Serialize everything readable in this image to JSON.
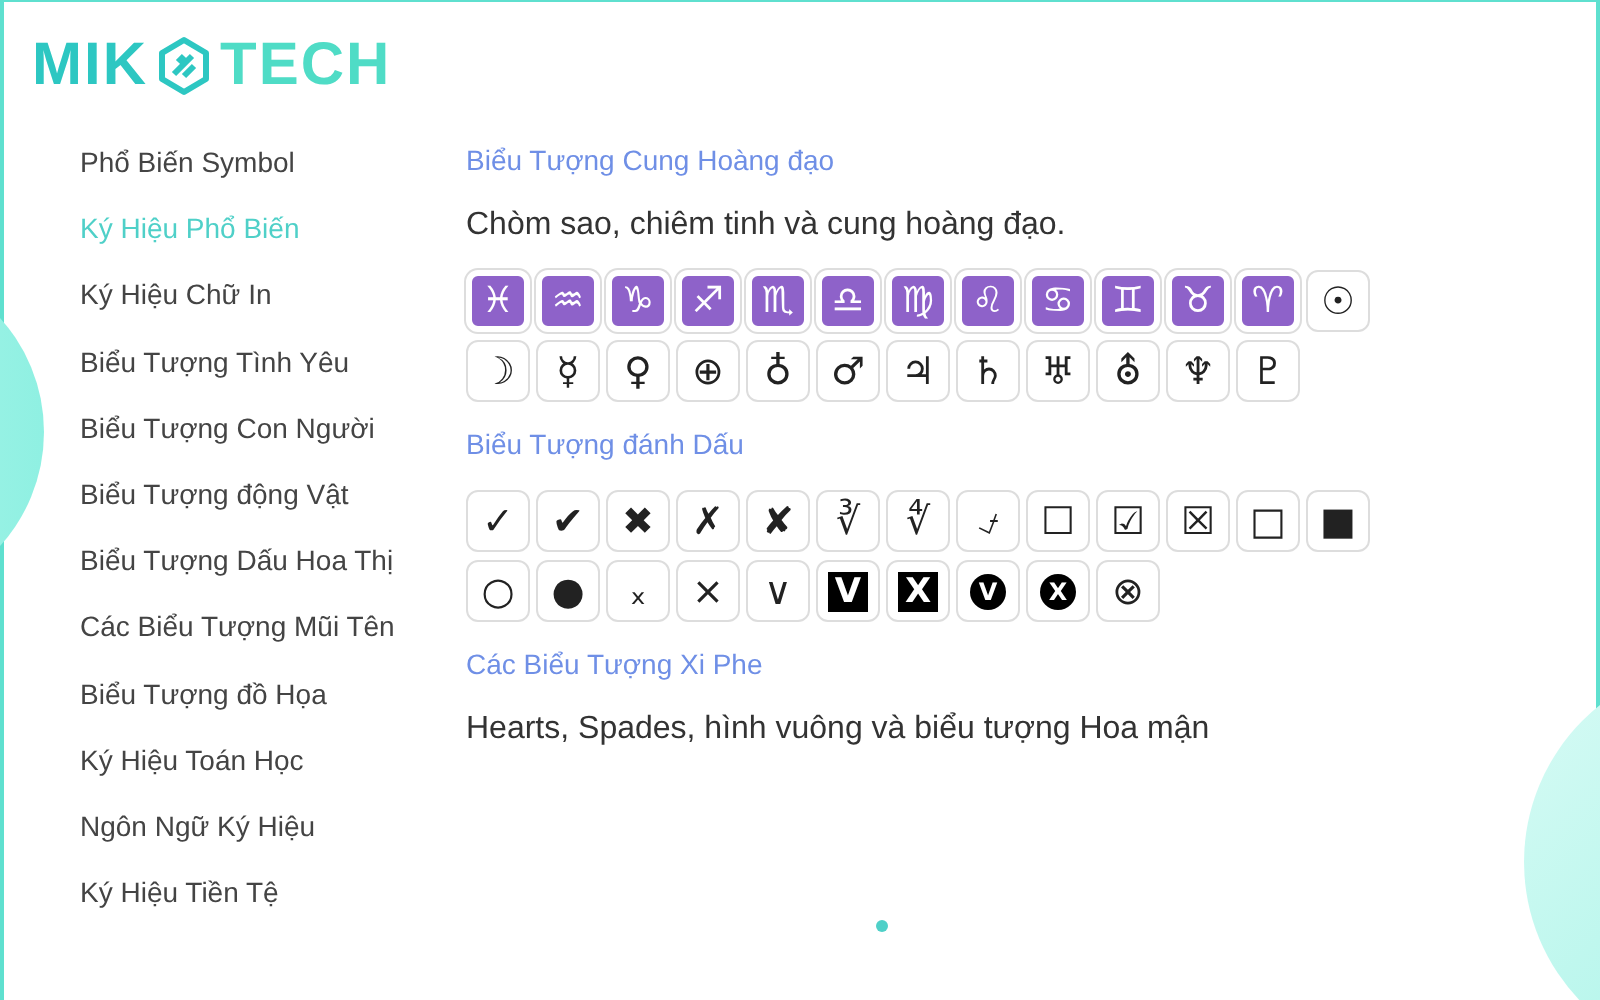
{
  "logo": {
    "left": "MIK",
    "right": "TECH"
  },
  "sidebar": {
    "items": [
      {
        "label": "Phổ Biến Symbol",
        "selected": false
      },
      {
        "label": "Ký Hiệu Phổ Biến",
        "selected": true
      },
      {
        "label": "Ký Hiệu Chữ In",
        "selected": false
      },
      {
        "label": "Biểu Tượng Tình Yêu",
        "selected": false
      },
      {
        "label": "Biểu Tượng Con Người",
        "selected": false
      },
      {
        "label": "Biểu Tượng động Vật",
        "selected": false
      },
      {
        "label": "Biểu Tượng Dấu Hoa Thị",
        "selected": false
      },
      {
        "label": "Các Biểu Tượng Mũi Tên",
        "selected": false
      },
      {
        "label": "Biểu Tượng đồ Họa",
        "selected": false
      },
      {
        "label": "Ký Hiệu Toán Học",
        "selected": false
      },
      {
        "label": "Ngôn Ngữ Ký Hiệu",
        "selected": false
      },
      {
        "label": "Ký Hiệu Tiền Tệ",
        "selected": false
      }
    ]
  },
  "sections": [
    {
      "title": "Biểu Tượng Cung Hoàng đạo",
      "description": "Chòm sao, chiêm tinh và cung hoàng đạo.",
      "symbols": [
        {
          "char": "♓",
          "kind": "zodiac"
        },
        {
          "char": "♒",
          "kind": "zodiac"
        },
        {
          "char": "♑",
          "kind": "zodiac"
        },
        {
          "char": "♐",
          "kind": "zodiac"
        },
        {
          "char": "♏",
          "kind": "zodiac"
        },
        {
          "char": "♎",
          "kind": "zodiac"
        },
        {
          "char": "♍",
          "kind": "zodiac"
        },
        {
          "char": "♌",
          "kind": "zodiac"
        },
        {
          "char": "♋",
          "kind": "zodiac"
        },
        {
          "char": "♊",
          "kind": "zodiac"
        },
        {
          "char": "♉",
          "kind": "zodiac"
        },
        {
          "char": "♈",
          "kind": "zodiac"
        },
        {
          "char": "☉",
          "kind": "plain"
        },
        {
          "char": "☽",
          "kind": "plain"
        },
        {
          "char": "☿",
          "kind": "plain"
        },
        {
          "char": "♀",
          "kind": "plain"
        },
        {
          "char": "⊕",
          "kind": "plain"
        },
        {
          "char": "♁",
          "kind": "plain"
        },
        {
          "char": "♂",
          "kind": "plain"
        },
        {
          "char": "♃",
          "kind": "plain"
        },
        {
          "char": "♄",
          "kind": "plain"
        },
        {
          "char": "♅",
          "kind": "plain"
        },
        {
          "char": "⛢",
          "kind": "plain"
        },
        {
          "char": "♆",
          "kind": "plain"
        },
        {
          "char": "♇",
          "kind": "plain"
        }
      ]
    },
    {
      "title": "Biểu Tượng đánh Dấu",
      "symbols": [
        {
          "char": "✓",
          "kind": "plain"
        },
        {
          "char": "✔",
          "kind": "plain"
        },
        {
          "char": "✖",
          "kind": "plain"
        },
        {
          "char": "✗",
          "kind": "plain"
        },
        {
          "char": "✘",
          "kind": "plain"
        },
        {
          "char": "∛",
          "kind": "plain"
        },
        {
          "char": "∜",
          "kind": "plain"
        },
        {
          "char": "⍻",
          "kind": "plain"
        },
        {
          "char": "☐",
          "kind": "plain"
        },
        {
          "char": "☑",
          "kind": "plain"
        },
        {
          "char": "☒",
          "kind": "plain"
        },
        {
          "char": "□",
          "kind": "plain"
        },
        {
          "char": "■",
          "kind": "plain"
        },
        {
          "char": "○",
          "kind": "plain"
        },
        {
          "char": "●",
          "kind": "plain"
        },
        {
          "char": "ₓ",
          "kind": "plain"
        },
        {
          "char": "×",
          "kind": "plain"
        },
        {
          "char": "∨",
          "kind": "plain"
        },
        {
          "char": "V",
          "kind": "inverse-square"
        },
        {
          "char": "X",
          "kind": "inverse-square"
        },
        {
          "char": "V",
          "kind": "inverse-circle"
        },
        {
          "char": "X",
          "kind": "inverse-circle"
        },
        {
          "char": "⊗",
          "kind": "plain"
        }
      ]
    },
    {
      "title": "Các Biểu Tượng Xi Phe",
      "description": "Hearts, Spades, hình vuông và biểu tượng Hoa mận"
    }
  ]
}
